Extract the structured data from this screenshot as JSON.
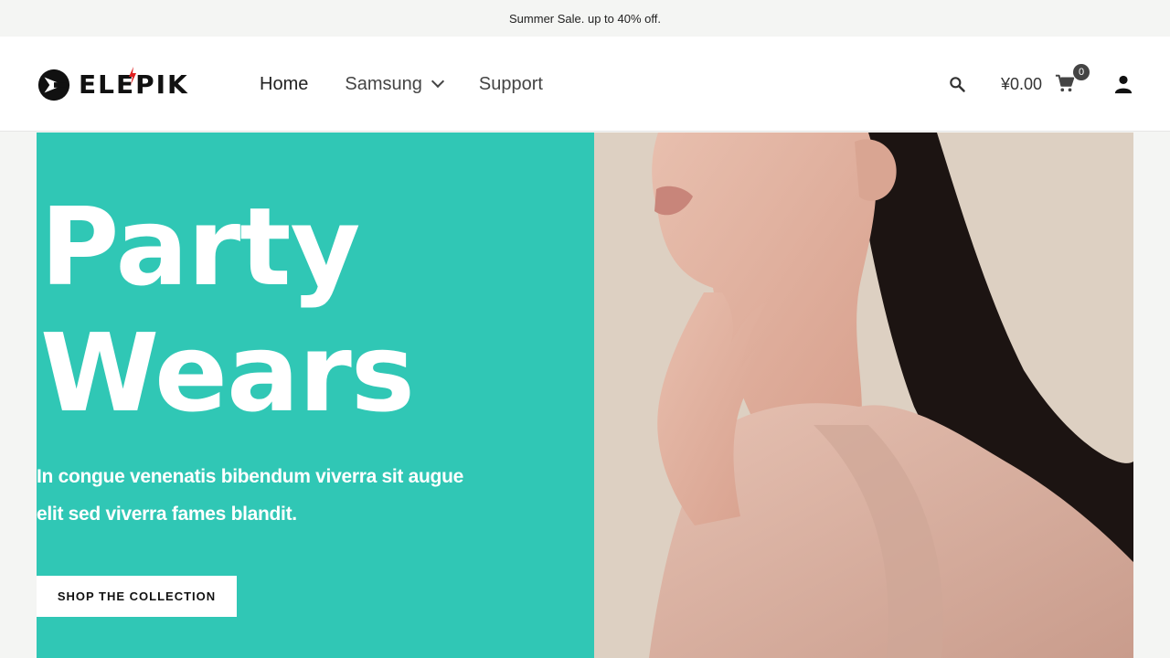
{
  "announcement": "Summer Sale. up to 40% off.",
  "brand": {
    "name": "ELEPIK"
  },
  "nav": {
    "items": [
      {
        "label": "Home"
      },
      {
        "label": "Samsung"
      },
      {
        "label": "Support"
      }
    ]
  },
  "header": {
    "cart_total": "¥0.00",
    "cart_count": "0",
    "icons": [
      "search-icon",
      "cart-icon",
      "user-icon",
      "chevron-down-icon"
    ]
  },
  "hero": {
    "title_line1": "Party",
    "title_line2": "Wears",
    "subtitle_line1": "In congue venenatis bibendum viverra sit augue",
    "subtitle_line2": "elit sed viverra fames blandit.",
    "cta_label": "SHOP THE COLLECTION"
  },
  "colors": {
    "hero_accent": "#30c7b5",
    "photo_backdrop": "#ddd0c2",
    "logo_bolt": "#e02020"
  }
}
